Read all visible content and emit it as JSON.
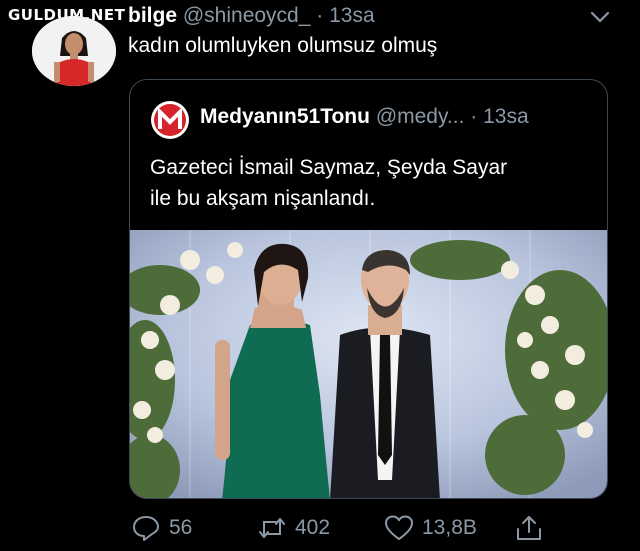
{
  "watermark": "GULDUM.NET",
  "tweet": {
    "display_name": "bilge",
    "handle": "@shineoycd_",
    "separator": "·",
    "time": "13sa",
    "text": "kadın olumluyken olumsuz olmuş"
  },
  "quote": {
    "display_name": "Medyanın51Tonu",
    "handle": "@medy...",
    "separator": "·",
    "time": "13sa",
    "text_line1": "Gazeteci İsmail Saymaz, Şeyda Sayar",
    "text_line2": "ile bu akşam nişanlandı.",
    "logo_letter": "M"
  },
  "actions": {
    "reply_count": "56",
    "retweet_count": "402",
    "like_count": "13,8B"
  },
  "colors": {
    "background": "#000000",
    "secondary_text": "#8b98a5",
    "border": "#3d4a55",
    "logo_red": "#d7232b",
    "dress_green": "#0f6b52"
  },
  "icons": {
    "reply": "reply-icon",
    "retweet": "retweet-icon",
    "like": "heart-icon",
    "share": "share-icon",
    "more": "chevron-down-icon"
  }
}
